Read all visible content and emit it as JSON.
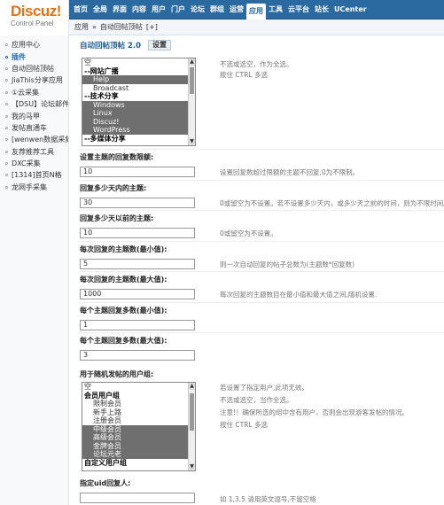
{
  "logo": {
    "name": "Discuz!",
    "subtitle": "Control Panel"
  },
  "topnav": [
    "首页",
    "全局",
    "界面",
    "内容",
    "用户",
    "门户",
    "论坛",
    "群组",
    "运营",
    "应用",
    "工具",
    "云平台",
    "站长",
    "UCenter"
  ],
  "topnav_active": 9,
  "breadcrumb": {
    "part1": "应用",
    "sep": "»",
    "part2": "自动回帖顶帖",
    "extra": "[+]"
  },
  "sidebar": [
    "应用中心",
    "插件",
    "自动回帖顶帖",
    "JiaThis分享应用",
    "①云采集",
    "【DSU】论坛邮件",
    "我的马甲",
    "发帖直通车",
    "[wenwen数据采集",
    "友荐推荐工具",
    "DXC采集",
    "[1314]首页N格",
    "龙网手采集"
  ],
  "sidebar_active": 1,
  "plugin": {
    "title": "自动回帖顶帖 2.0",
    "tab": "设置"
  },
  "forum_select": {
    "options": [
      {
        "text": "空",
        "type": "plain",
        "selected": false
      },
      {
        "text": "--网站广播",
        "type": "group",
        "selected": false
      },
      {
        "text": "Help",
        "type": "indent",
        "selected": true
      },
      {
        "text": "Broadcast",
        "type": "indent",
        "selected": false
      },
      {
        "text": "--技术分享",
        "type": "group",
        "selected": false
      },
      {
        "text": "Windows",
        "type": "indent",
        "selected": true
      },
      {
        "text": "Linux",
        "type": "indent",
        "selected": true
      },
      {
        "text": "Discuz!",
        "type": "indent",
        "selected": true
      },
      {
        "text": "WordPress",
        "type": "indent",
        "selected": true
      },
      {
        "text": "--多媒体分享",
        "type": "group",
        "selected": false
      }
    ],
    "hint1": "不选或选空，作为全选。",
    "hint2": "按住 CTRL 多选"
  },
  "fields": [
    {
      "label": "设置主题的回复数限额:",
      "value": "10",
      "hint": "设置回复数超过限额的主题不回复,0为不限制。"
    },
    {
      "label": "回复多少天内的主题:",
      "value": "30",
      "hint": "0或留空为不设置。若不设置多少天内，或多少天之前的时间，则为不限时间。"
    },
    {
      "label": "回复多少天以前的主题:",
      "value": "10",
      "hint": "0或留空为不设置。"
    },
    {
      "label": "每次回复的主题数(最小值):",
      "value": "5",
      "hint": "则一次自动回复的帖子总数为(主题数*回复数)"
    },
    {
      "label": "每次回复的主题数(最大值):",
      "value": "1000",
      "hint": "每次回复的主题数目在最小值和最大值之间,随机设置."
    },
    {
      "label": "每个主题回复多数(最小值):",
      "value": "1",
      "hint": ""
    },
    {
      "label": "每个主题回复多数(最大值):",
      "value": "3",
      "hint": ""
    }
  ],
  "usergroup": {
    "label": "用于随机发帖的用户组:",
    "options": [
      {
        "text": "空",
        "type": "plain",
        "selected": false
      },
      {
        "text": "会员用户组",
        "type": "group",
        "selected": false
      },
      {
        "text": "限制会员",
        "type": "indent",
        "selected": false
      },
      {
        "text": "新手上路",
        "type": "indent",
        "selected": false
      },
      {
        "text": "注册会员",
        "type": "indent",
        "selected": false
      },
      {
        "text": "中级会员",
        "type": "indent",
        "selected": true
      },
      {
        "text": "高级会员",
        "type": "indent",
        "selected": true
      },
      {
        "text": "金牌会员",
        "type": "indent",
        "selected": true
      },
      {
        "text": "论坛元老",
        "type": "indent",
        "selected": true
      },
      {
        "text": "自定义用户组",
        "type": "group",
        "selected": false
      }
    ],
    "hint1": "若设置了指定用户,此项无效。",
    "hint2": "不选或选空，当作全选。",
    "hint3": "注意!！确保所选的组中含有用户，否则会出现游客发帖的情况。",
    "hint4": "按住 CTRL 多选"
  },
  "uid_field": {
    "label": "指定uid回复人:",
    "value": "",
    "hint": "如 1,3,5 请用英文逗号,不留空格"
  }
}
